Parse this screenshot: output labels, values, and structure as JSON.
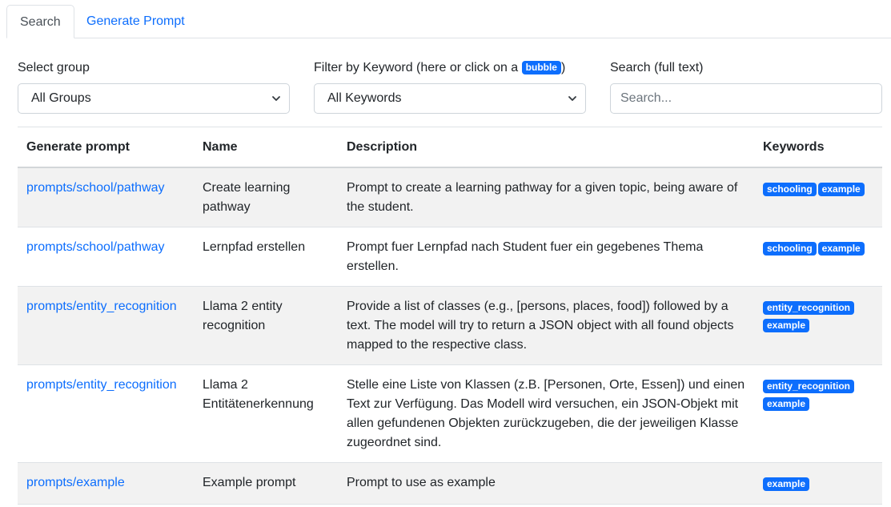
{
  "tabs": [
    {
      "label": "Search",
      "active": true
    },
    {
      "label": "Generate Prompt",
      "active": false
    }
  ],
  "filters": {
    "group": {
      "label": "Select group",
      "value": "All Groups"
    },
    "keyword": {
      "label_prefix": "Filter by Keyword (here or click on a ",
      "label_badge": "bubble",
      "label_suffix": ")",
      "value": "All Keywords"
    },
    "search": {
      "label": "Search (full text)",
      "placeholder": "Search..."
    }
  },
  "table": {
    "headers": [
      "Generate prompt",
      "Name",
      "Description",
      "Keywords"
    ],
    "rows": [
      {
        "link": "prompts/school/pathway",
        "name": "Create learning pathway",
        "description": "Prompt to create a learning pathway for a given topic, being aware of the student.",
        "keywords": [
          "schooling",
          "example"
        ]
      },
      {
        "link": "prompts/school/pathway",
        "name": "Lernpfad erstellen",
        "description": "Prompt fuer Lernpfad nach Student fuer ein gegebenes Thema erstellen.",
        "keywords": [
          "schooling",
          "example"
        ]
      },
      {
        "link": "prompts/entity_recognition",
        "name": "Llama 2 entity recognition",
        "description": "Provide a list of classes (e.g., [persons, places, food]) followed by a text. The model will try to return a JSON object with all found objects mapped to the respective class.",
        "keywords": [
          "entity_recognition",
          "example"
        ]
      },
      {
        "link": "prompts/entity_recognition",
        "name": "Llama 2 Entitätenerkennung",
        "description": "Stelle eine Liste von Klassen (z.B. [Personen, Orte, Essen]) und einen Text zur Verfügung. Das Modell wird versuchen, ein JSON-Objekt mit allen gefundenen Objekten zurückzugeben, die der jeweiligen Klasse zugeordnet sind.",
        "keywords": [
          "entity_recognition",
          "example"
        ]
      },
      {
        "link": "prompts/example",
        "name": "Example prompt",
        "description": "Prompt to use as example",
        "keywords": [
          "example"
        ]
      }
    ]
  },
  "colors": {
    "accent": "#0d6efd",
    "stripe": "#f2f2f2",
    "border": "#dee2e6"
  },
  "icons": {
    "select_caret": "chevron-down-icon"
  }
}
